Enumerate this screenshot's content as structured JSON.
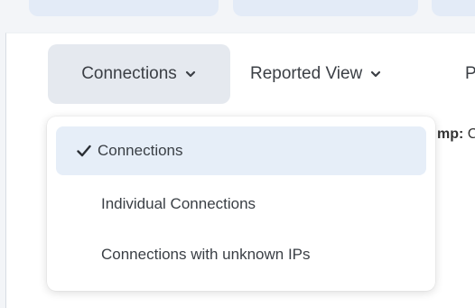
{
  "toolbar": {
    "connections_label": "Connections",
    "reported_view_label": "Reported View",
    "next_label_partial": "P"
  },
  "background": {
    "partial_label_bold": "mp:",
    "partial_value": " C"
  },
  "dropdown": {
    "items": [
      {
        "label": "Connections",
        "selected": true
      },
      {
        "label": "Individual Connections",
        "selected": false
      },
      {
        "label": "Connections with unknown IPs",
        "selected": false
      }
    ]
  },
  "colors": {
    "active_button_bg": "#e5e9ef",
    "selected_item_bg": "#e6eef8",
    "top_tab_bg": "#e3ebf7"
  },
  "icons": {
    "dropdown_chevron": "chevron-down-icon",
    "selected_marker": "checkmark-icon"
  }
}
